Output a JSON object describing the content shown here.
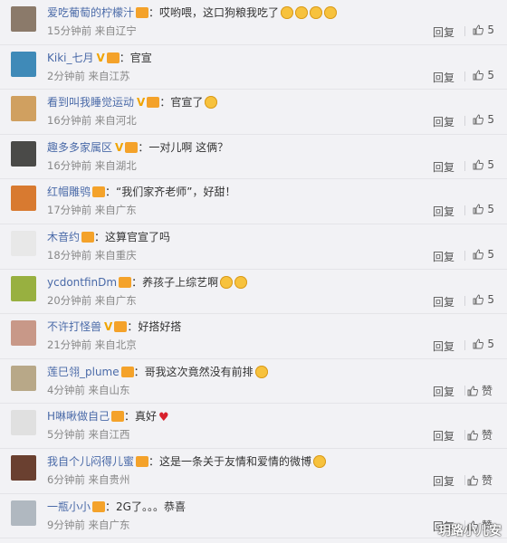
{
  "comments": [
    {
      "user": "爱吃葡萄的柠檬汁",
      "verified": false,
      "text": "：哎哟喂，这口狗粮我吃了",
      "emojis": 4,
      "time": "15分钟前",
      "loc": "来自辽宁",
      "reply": "回复",
      "likes": "5",
      "avatar_color": "#8b7a6a"
    },
    {
      "user": "Kiki_七月",
      "verified": true,
      "text": "：官宣",
      "emojis": 0,
      "time": "2分钟前",
      "loc": "来自江苏",
      "reply": "回复",
      "likes": "5",
      "avatar_color": "#3f8ab8"
    },
    {
      "user": "看到叫我睡觉运动",
      "verified": true,
      "text": "：官宣了",
      "emojis": 1,
      "time": "16分钟前",
      "loc": "来自河北",
      "reply": "回复",
      "likes": "5",
      "avatar_color": "#d0a060"
    },
    {
      "user": "趣多多家属区",
      "verified": true,
      "text": "：一对儿啊 这俩？",
      "emojis": 0,
      "time": "16分钟前",
      "loc": "来自湖北",
      "reply": "回复",
      "likes": "5",
      "avatar_color": "#4a4a48"
    },
    {
      "user": "红帽雕鸮",
      "verified": false,
      "text": "：“我们家齐老师”，好甜！",
      "emojis": 0,
      "time": "17分钟前",
      "loc": "来自广东",
      "reply": "回复",
      "likes": "5",
      "avatar_color": "#d87a30"
    },
    {
      "user": "木音约",
      "verified": false,
      "text": "：这算官宣了吗",
      "emojis": 0,
      "time": "18分钟前",
      "loc": "来自重庆",
      "reply": "回复",
      "likes": "5",
      "avatar_color": "#e8e8e8"
    },
    {
      "user": "ycdontfinDm",
      "verified": false,
      "text": "：养孩子上综艺啊",
      "emojis": 2,
      "time": "20分钟前",
      "loc": "来自广东",
      "reply": "回复",
      "likes": "5",
      "avatar_color": "#98b040"
    },
    {
      "user": "不许打怪兽",
      "verified": true,
      "text": "：好搭好搭",
      "emojis": 0,
      "time": "21分钟前",
      "loc": "来自北京",
      "reply": "回复",
      "likes": "5",
      "avatar_color": "#c89888"
    },
    {
      "user": "莲巳翎_plume",
      "verified": false,
      "text": "：哥我这次竟然没有前排",
      "emojis": 1,
      "time": "4分钟前",
      "loc": "来自山东",
      "reply": "回复",
      "likes": "赞",
      "avatar_color": "#b8a888"
    },
    {
      "user": "H啉啾做自己",
      "verified": false,
      "text": "：真好",
      "emojis": 0,
      "heart": true,
      "time": "5分钟前",
      "loc": "来自江西",
      "reply": "回复",
      "likes": "赞",
      "avatar_color": "#e0e0e0"
    },
    {
      "user": "我自个儿闷得儿蜜",
      "verified": false,
      "text": "：这是一条关于友情和爱情的微博",
      "emojis": 1,
      "time": "6分钟前",
      "loc": "来自贵州",
      "reply": "回复",
      "likes": "赞",
      "avatar_color": "#6a4030"
    },
    {
      "user": "一瓶小小",
      "verified": false,
      "text": "：2G了。。。恭喜",
      "emojis": 0,
      "time": "9分钟前",
      "loc": "来自广东",
      "reply": "回复",
      "likes": "赞",
      "avatar_color": "#b0b8c0"
    }
  ],
  "watermark": "玥路小儿安"
}
